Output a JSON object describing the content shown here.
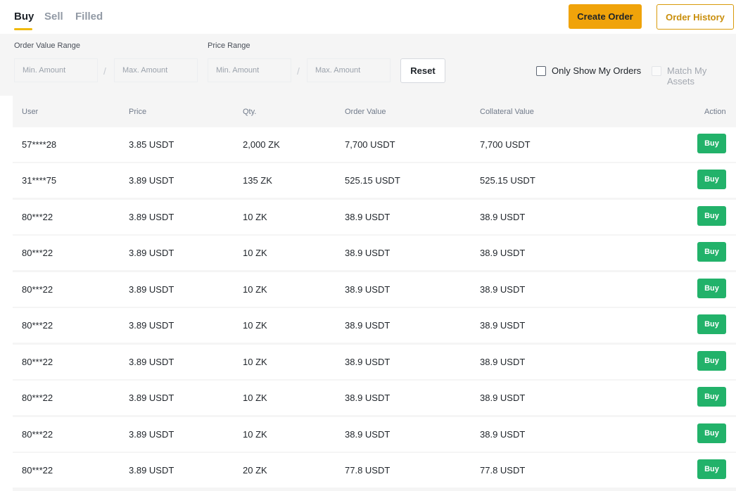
{
  "tabs": [
    "Buy",
    "Sell",
    "Filled"
  ],
  "actions": {
    "create_order": "Create Order",
    "order_history": "Order History"
  },
  "filters": {
    "order_value_range": "Order Value Range",
    "price_range": "Price Range",
    "min_placeholder": "Min. Amount",
    "max_placeholder": "Max. Amount",
    "separator": "/",
    "reset": "Reset",
    "only_show_my_orders": "Only Show My Orders",
    "match_my_assets": "Match My Assets"
  },
  "columns": [
    "User",
    "Price",
    "Qty.",
    "Order Value",
    "Collateral Value",
    "Action"
  ],
  "rows": [
    {
      "user": "57****28",
      "price": "3.85 USDT",
      "qty": "2,000 ZK",
      "order_value": "7,700 USDT",
      "collateral": "7,700 USDT",
      "action": "Buy"
    },
    {
      "user": "31****75",
      "price": "3.89 USDT",
      "qty": "135 ZK",
      "order_value": "525.15 USDT",
      "collateral": "525.15 USDT",
      "action": "Buy"
    },
    {
      "user": "80***22",
      "price": "3.89 USDT",
      "qty": "10 ZK",
      "order_value": "38.9 USDT",
      "collateral": "38.9 USDT",
      "action": "Buy"
    },
    {
      "user": "80***22",
      "price": "3.89 USDT",
      "qty": "10 ZK",
      "order_value": "38.9 USDT",
      "collateral": "38.9 USDT",
      "action": "Buy"
    },
    {
      "user": "80***22",
      "price": "3.89 USDT",
      "qty": "10 ZK",
      "order_value": "38.9 USDT",
      "collateral": "38.9 USDT",
      "action": "Buy"
    },
    {
      "user": "80***22",
      "price": "3.89 USDT",
      "qty": "10 ZK",
      "order_value": "38.9 USDT",
      "collateral": "38.9 USDT",
      "action": "Buy"
    },
    {
      "user": "80***22",
      "price": "3.89 USDT",
      "qty": "10 ZK",
      "order_value": "38.9 USDT",
      "collateral": "38.9 USDT",
      "action": "Buy"
    },
    {
      "user": "80***22",
      "price": "3.89 USDT",
      "qty": "10 ZK",
      "order_value": "38.9 USDT",
      "collateral": "38.9 USDT",
      "action": "Buy"
    },
    {
      "user": "80***22",
      "price": "3.89 USDT",
      "qty": "10 ZK",
      "order_value": "38.9 USDT",
      "collateral": "38.9 USDT",
      "action": "Buy"
    },
    {
      "user": "80***22",
      "price": "3.89 USDT",
      "qty": "20 ZK",
      "order_value": "77.8 USDT",
      "collateral": "77.8 USDT",
      "action": "Buy"
    }
  ],
  "colors": {
    "accent": "#f0a30a",
    "buy": "#22b26a",
    "history_outline": "#d89a0a"
  }
}
